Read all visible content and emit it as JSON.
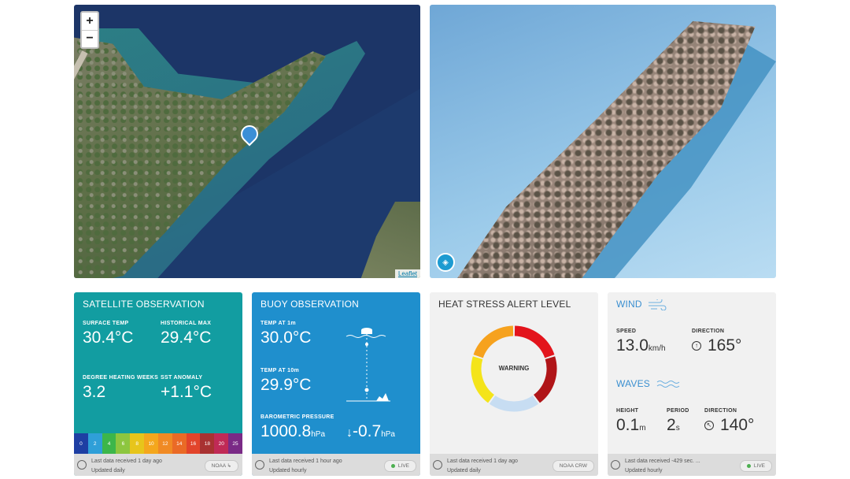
{
  "map": {
    "zoom_in": "+",
    "zoom_out": "−",
    "attribution": "Leaflet",
    "marker_icon": "location-pin-icon"
  },
  "model": {
    "viewer_icon": "cube-icon"
  },
  "satellite": {
    "title": "SATELLITE OBSERVATION",
    "surface_temp_label": "SURFACE TEMP",
    "surface_temp": "30.4°C",
    "historical_max_label": "HISTORICAL MAX",
    "historical_max": "29.4°C",
    "dhw_label": "DEGREE HEATING WEEKS",
    "dhw": "3.2",
    "sst_anomaly_label": "SST ANOMALY",
    "sst_anomaly": "+1.1°C",
    "scale": [
      {
        "label": "0",
        "color": "#1e3fa3"
      },
      {
        "label": "2",
        "color": "#2f9fd8"
      },
      {
        "label": "4",
        "color": "#3cb64a"
      },
      {
        "label": "6",
        "color": "#8dc63f"
      },
      {
        "label": "8",
        "color": "#e7c51b"
      },
      {
        "label": "10",
        "color": "#f4a71d"
      },
      {
        "label": "12",
        "color": "#f08a24"
      },
      {
        "label": "14",
        "color": "#ea6a26"
      },
      {
        "label": "16",
        "color": "#e2442b"
      },
      {
        "label": "18",
        "color": "#a83232"
      },
      {
        "label": "20",
        "color": "#c02a56"
      },
      {
        "label": "25",
        "color": "#7a2a86"
      }
    ],
    "footer_line1": "Last data received 1 day ago",
    "footer_line2": "Updated daily",
    "source": "NOAA"
  },
  "buoy": {
    "title": "BUOY OBSERVATION",
    "temp1m_label": "TEMP AT 1m",
    "temp1m": "30.0°C",
    "temp10m_label": "TEMP AT 10m",
    "temp10m": "29.9°C",
    "pressure_label": "BAROMETRIC PRESSURE",
    "pressure": "1000.8",
    "pressure_unit": "hPa",
    "pressure_trend": "-0.7",
    "pressure_trend_unit": "hPa",
    "footer_line1": "Last data received 1 hour ago",
    "footer_line2": "Updated hourly",
    "status": "LIVE"
  },
  "heat": {
    "title": "HEAT STRESS ALERT LEVEL",
    "level": "WARNING",
    "ring_colors": [
      "#e3141c",
      "#b01518",
      "#c7ddf2",
      "#f4e41a",
      "#f6a21e"
    ],
    "footer_line1": "Last data received 1 day ago",
    "footer_line2": "Updated daily",
    "source": "NOAA CRW"
  },
  "wind": {
    "wind_title": "WIND",
    "speed_label": "SPEED",
    "speed": "13.0",
    "speed_unit": "km/h",
    "direction_label": "DIRECTION",
    "direction": "165°",
    "waves_title": "WAVES",
    "height_label": "HEIGHT",
    "height": "0.1",
    "height_unit": "m",
    "period_label": "PERIOD",
    "period": "2",
    "period_unit": "s",
    "wave_direction_label": "DIRECTION",
    "wave_direction": "140°",
    "footer_line1": "Last data received -429 sec. ...",
    "footer_line2": "Updated hourly",
    "status": "LIVE"
  }
}
